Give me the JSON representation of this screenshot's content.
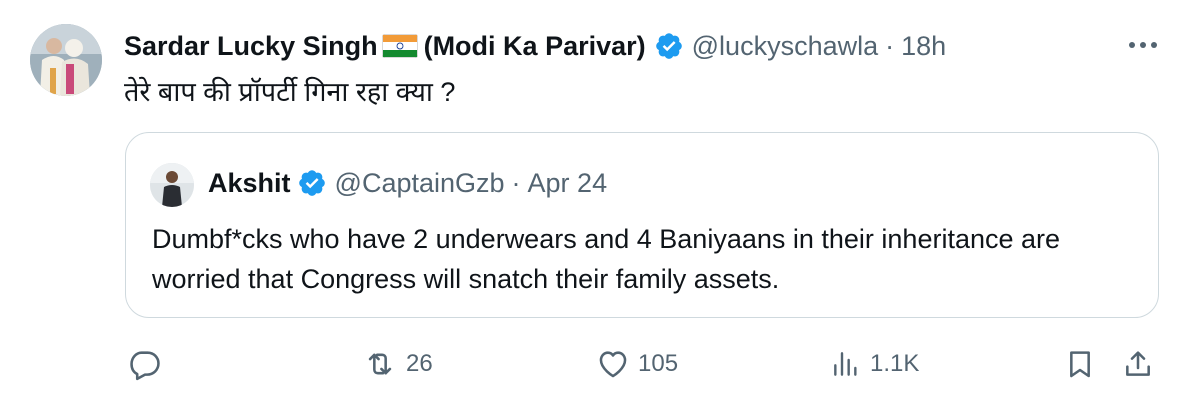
{
  "tweet": {
    "author_name": "Sardar Lucky Singh",
    "author_suffix": "(Modi Ka Parivar)",
    "handle": "@luckyschawla",
    "separator": "·",
    "time": "18h",
    "text": "तेरे बाप की प्रॉपर्टी गिना रहा क्या ?"
  },
  "quoted": {
    "author_name": "Akshit",
    "handle": "@CaptainGzb",
    "separator": "·",
    "date": "Apr 24",
    "text": "Dumbf*cks who have 2 underwears and 4 Baniyaans in their inheritance are worried that Congress will snatch their family assets."
  },
  "actions": {
    "reply_count": "",
    "retweet_count": "26",
    "like_count": "105",
    "views_count": "1.1K"
  },
  "icons": {
    "verified": "verified-badge-icon",
    "flag": "india-flag-icon",
    "more": "more-icon",
    "reply": "reply-icon",
    "retweet": "retweet-icon",
    "like": "like-icon",
    "views": "views-icon",
    "bookmark": "bookmark-icon",
    "share": "share-icon"
  },
  "colors": {
    "verified_blue": "#1d9bf0",
    "muted_text": "#536471",
    "text": "#0f1419",
    "border": "#cfd9de"
  }
}
